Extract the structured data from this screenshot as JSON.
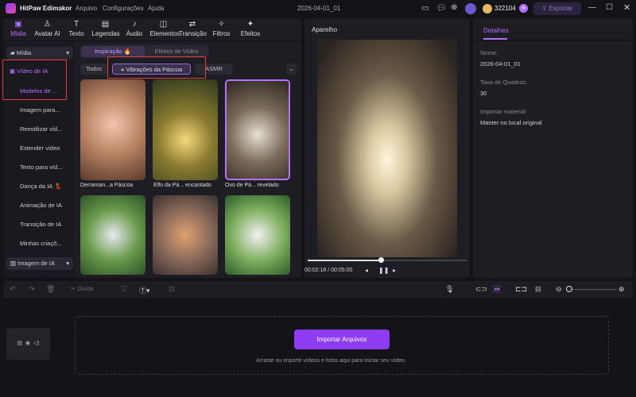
{
  "app": {
    "title": "HitPaw Edimakor",
    "menu": [
      "Arquivo",
      "Configurações",
      "Ajuda"
    ],
    "project": "2026-04-01_01",
    "credits": "322104",
    "export": "Exportar"
  },
  "toolbar": [
    {
      "label": "Mídia",
      "icon": "▣"
    },
    {
      "label": "Avatar AI",
      "icon": "♙"
    },
    {
      "label": "Texto",
      "icon": "T"
    },
    {
      "label": "Legendas",
      "icon": "▤"
    },
    {
      "label": "Áudio",
      "icon": "♪"
    },
    {
      "label": "Elementos",
      "icon": "◫"
    },
    {
      "label": "Transição",
      "icon": "⇄"
    },
    {
      "label": "Filtros",
      "icon": "✧"
    },
    {
      "label": "Efeitos",
      "icon": "✦"
    }
  ],
  "sidebar": {
    "media": "Mídia",
    "video_ai": "Vídeo de IA",
    "items": [
      "Modelos de ...",
      "Imagem para...",
      "Reestilizar víd...",
      "Estender vídeo",
      "Texto para víd...",
      "Dança da IA 💃",
      "Animação de IA",
      "Transição de IA",
      "Minhas criaçõ..."
    ],
    "image_ai": "Imagem de IA"
  },
  "content": {
    "tabs": [
      "Inspiração 🔥",
      "Efeitos de Vídeo"
    ],
    "filters": [
      "Todos",
      "Vibrações da Páscoa",
      "ASMR"
    ],
    "cards": [
      "Derraman...a Páscoa",
      "Elfo da Pá... encantado",
      "Ovo de Pá... revelado"
    ]
  },
  "preview": {
    "title": "Aparelho",
    "time": "00:02:18 / 00:05:00",
    "progress": 0.46
  },
  "details": {
    "tab": "Detalhes",
    "name_label": "Nome:",
    "name": "2026-04-01_01",
    "fps_label": "Taxa de Quadros:",
    "fps": "30",
    "import_label": "Importar material:",
    "import": "Manter no local original"
  },
  "timeline": {
    "split": "Dividir",
    "import_button": "Importar Arquivos",
    "hint": "Arraste ou importe vídeos e fotos aqui para iniciar seu vídeo."
  }
}
